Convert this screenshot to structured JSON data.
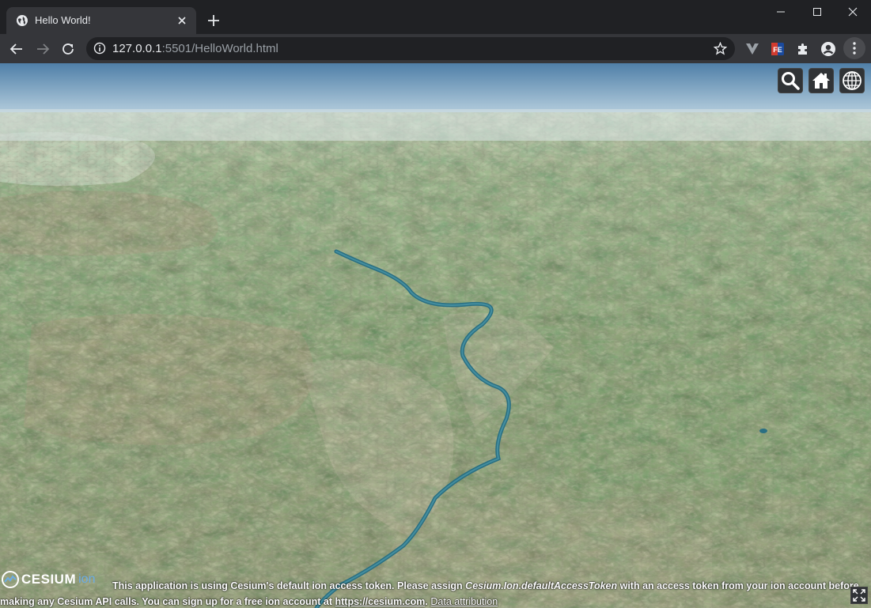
{
  "browser": {
    "tab_title": "Hello World!",
    "url_host": "127.0.0.1",
    "url_rest": ":5501/HelloWorld.html"
  },
  "viewer": {
    "toolbar_buttons": [
      "search-icon",
      "home-icon",
      "globe-icon"
    ],
    "logo_text": "CESIUM",
    "logo_suffix": "ion",
    "credit_line1_a": "This application is using Cesium's default ion access token. Please assign ",
    "credit_line1_em": "Cesium.Ion.defaultAccessToken",
    "credit_line1_b": " with an access token from your ion account before",
    "credit_line2_a": "making any Cesium API calls. You can sign up for a free ion account at ",
    "credit_link": "https://cesium.com",
    "credit_line2_b": ".",
    "data_attribution": "Data attribution"
  },
  "colors": {
    "browser_frame": "#202124",
    "toolbar": "#35363a",
    "cesium_button": "#303336",
    "river": "#2a6f82"
  }
}
